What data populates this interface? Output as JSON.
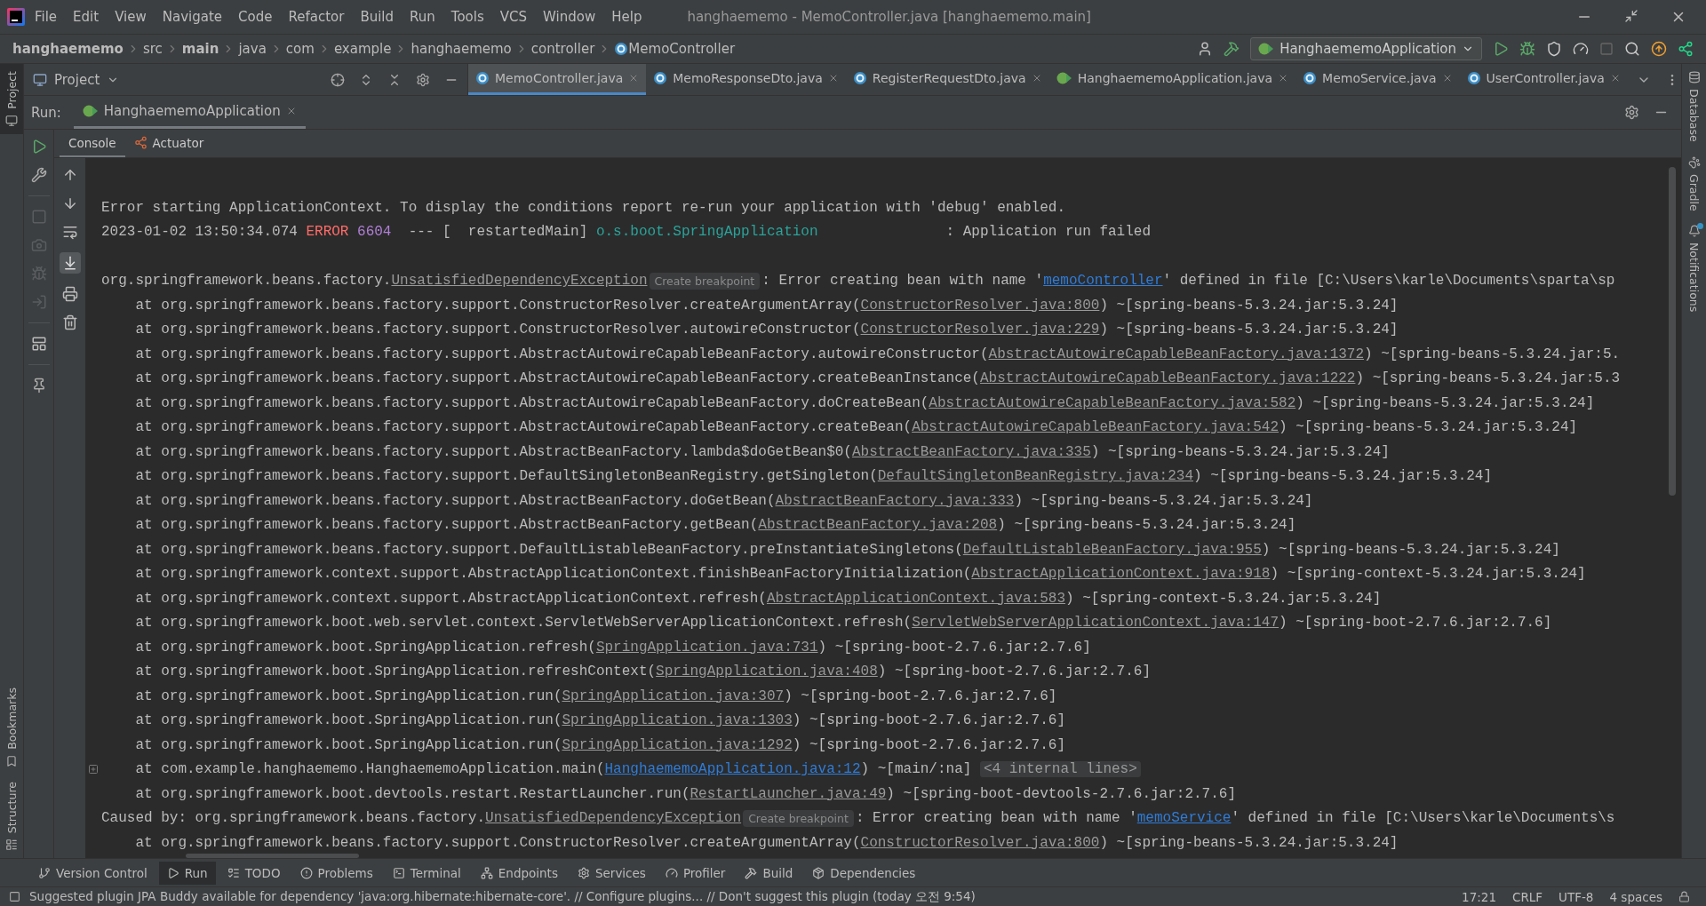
{
  "title_bar": {
    "menu": [
      "File",
      "Edit",
      "View",
      "Navigate",
      "Code",
      "Refactor",
      "Build",
      "Run",
      "Tools",
      "VCS",
      "Window",
      "Help"
    ],
    "title": "hanghaememo - MemoController.java [hanghaememo.main]"
  },
  "nav_bar": {
    "breadcrumbs": [
      {
        "text": "hanghaememo",
        "bold": true,
        "kind": "folder"
      },
      {
        "text": "src",
        "bold": false,
        "kind": "folder"
      },
      {
        "text": "main",
        "bold": true,
        "kind": "folder"
      },
      {
        "text": "java",
        "bold": false,
        "kind": "folder"
      },
      {
        "text": "com",
        "bold": false,
        "kind": "folder"
      },
      {
        "text": "example",
        "bold": false,
        "kind": "folder"
      },
      {
        "text": "hanghaememo",
        "bold": false,
        "kind": "folder"
      },
      {
        "text": "controller",
        "bold": false,
        "kind": "folder"
      },
      {
        "text": "MemoController",
        "bold": false,
        "kind": "class"
      }
    ],
    "run_config": "HanghaememoApplication"
  },
  "project_panel": {
    "title": "Project"
  },
  "editor_tabs": [
    {
      "label": "MemoController.java",
      "selected": true,
      "kind": "class"
    },
    {
      "label": "MemoResponseDto.java",
      "selected": false,
      "kind": "class"
    },
    {
      "label": "RegisterRequestDto.java",
      "selected": false,
      "kind": "class"
    },
    {
      "label": "HanghaememoApplication.java",
      "selected": false,
      "kind": "app"
    },
    {
      "label": "MemoService.java",
      "selected": false,
      "kind": "class"
    },
    {
      "label": "UserController.java",
      "selected": false,
      "kind": "class"
    }
  ],
  "run_panel": {
    "label": "Run:",
    "tabs": [
      {
        "label": "HanghaememoApplication",
        "selected": true
      }
    ],
    "console_tabs": [
      {
        "label": "Console",
        "selected": true,
        "kind": "plain"
      },
      {
        "label": "Actuator",
        "selected": false,
        "kind": "actuator"
      }
    ],
    "lines": [
      {
        "spaced": false,
        "parts": [
          {
            "kind": "text",
            "text": "Error starting ApplicationContext. To display the conditions report re-run your application with 'debug' enabled."
          }
        ]
      },
      {
        "spaced": false,
        "parts": [
          {
            "kind": "text",
            "text": "2023-01-02 13:50:34.074 "
          },
          {
            "kind": "error",
            "text": "ERROR"
          },
          {
            "kind": "pid",
            "text": "6604"
          },
          {
            "kind": "text",
            "text": " --- [  restartedMain] "
          },
          {
            "kind": "logger",
            "text": "o.s.boot.SpringApplication"
          },
          {
            "kind": "text",
            "text": "               : Application run failed"
          }
        ]
      },
      {
        "spaced": true,
        "parts": [
          {
            "kind": "text",
            "text": "org.springframework.beans.factory."
          },
          {
            "kind": "link",
            "text": "UnsatisfiedDependencyException"
          },
          {
            "kind": "hint",
            "text": "Create breakpoint"
          },
          {
            "kind": "text",
            "text": ": Error creating bean with name '"
          },
          {
            "kind": "url",
            "text": "memoController"
          },
          {
            "kind": "text",
            "text": "' defined in file [C:\\Users\\karle\\Documents\\sparta\\sp"
          }
        ]
      },
      {
        "spaced": false,
        "parts": [
          {
            "kind": "text",
            "text": "    at org.springframework.beans.factory.support.ConstructorResolver.createArgumentArray("
          },
          {
            "kind": "link",
            "text": "ConstructorResolver.java:800"
          },
          {
            "kind": "text",
            "text": ") ~[spring-beans-5.3.24.jar:5.3.24]"
          }
        ]
      },
      {
        "spaced": false,
        "parts": [
          {
            "kind": "text",
            "text": "    at org.springframework.beans.factory.support.ConstructorResolver.autowireConstructor("
          },
          {
            "kind": "link",
            "text": "ConstructorResolver.java:229"
          },
          {
            "kind": "text",
            "text": ") ~[spring-beans-5.3.24.jar:5.3.24]"
          }
        ]
      },
      {
        "spaced": false,
        "parts": [
          {
            "kind": "text",
            "text": "    at org.springframework.beans.factory.support.AbstractAutowireCapableBeanFactory.autowireConstructor("
          },
          {
            "kind": "link",
            "text": "AbstractAutowireCapableBeanFactory.java:1372"
          },
          {
            "kind": "text",
            "text": ") ~[spring-beans-5.3.24.jar:5."
          }
        ]
      },
      {
        "spaced": false,
        "parts": [
          {
            "kind": "text",
            "text": "    at org.springframework.beans.factory.support.AbstractAutowireCapableBeanFactory.createBeanInstance("
          },
          {
            "kind": "link",
            "text": "AbstractAutowireCapableBeanFactory.java:1222"
          },
          {
            "kind": "text",
            "text": ") ~[spring-beans-5.3.24.jar:5.3"
          }
        ]
      },
      {
        "spaced": false,
        "parts": [
          {
            "kind": "text",
            "text": "    at org.springframework.beans.factory.support.AbstractAutowireCapableBeanFactory.doCreateBean("
          },
          {
            "kind": "link",
            "text": "AbstractAutowireCapableBeanFactory.java:582"
          },
          {
            "kind": "text",
            "text": ") ~[spring-beans-5.3.24.jar:5.3.24]"
          }
        ]
      },
      {
        "spaced": false,
        "parts": [
          {
            "kind": "text",
            "text": "    at org.springframework.beans.factory.support.AbstractAutowireCapableBeanFactory.createBean("
          },
          {
            "kind": "link",
            "text": "AbstractAutowireCapableBeanFactory.java:542"
          },
          {
            "kind": "text",
            "text": ") ~[spring-beans-5.3.24.jar:5.3.24]"
          }
        ]
      },
      {
        "spaced": false,
        "parts": [
          {
            "kind": "text",
            "text": "    at org.springframework.beans.factory.support.AbstractBeanFactory.lambda$doGetBean$0("
          },
          {
            "kind": "link",
            "text": "AbstractBeanFactory.java:335"
          },
          {
            "kind": "text",
            "text": ") ~[spring-beans-5.3.24.jar:5.3.24]"
          }
        ]
      },
      {
        "spaced": false,
        "parts": [
          {
            "kind": "text",
            "text": "    at org.springframework.beans.factory.support.DefaultSingletonBeanRegistry.getSingleton("
          },
          {
            "kind": "link",
            "text": "DefaultSingletonBeanRegistry.java:234"
          },
          {
            "kind": "text",
            "text": ") ~[spring-beans-5.3.24.jar:5.3.24]"
          }
        ]
      },
      {
        "spaced": false,
        "parts": [
          {
            "kind": "text",
            "text": "    at org.springframework.beans.factory.support.AbstractBeanFactory.doGetBean("
          },
          {
            "kind": "link",
            "text": "AbstractBeanFactory.java:333"
          },
          {
            "kind": "text",
            "text": ") ~[spring-beans-5.3.24.jar:5.3.24]"
          }
        ]
      },
      {
        "spaced": false,
        "parts": [
          {
            "kind": "text",
            "text": "    at org.springframework.beans.factory.support.AbstractBeanFactory.getBean("
          },
          {
            "kind": "link",
            "text": "AbstractBeanFactory.java:208"
          },
          {
            "kind": "text",
            "text": ") ~[spring-beans-5.3.24.jar:5.3.24]"
          }
        ]
      },
      {
        "spaced": false,
        "parts": [
          {
            "kind": "text",
            "text": "    at org.springframework.beans.factory.support.DefaultListableBeanFactory.preInstantiateSingletons("
          },
          {
            "kind": "link",
            "text": "DefaultListableBeanFactory.java:955"
          },
          {
            "kind": "text",
            "text": ") ~[spring-beans-5.3.24.jar:5.3.24]"
          }
        ]
      },
      {
        "spaced": false,
        "parts": [
          {
            "kind": "text",
            "text": "    at org.springframework.context.support.AbstractApplicationContext.finishBeanFactoryInitialization("
          },
          {
            "kind": "link",
            "text": "AbstractApplicationContext.java:918"
          },
          {
            "kind": "text",
            "text": ") ~[spring-context-5.3.24.jar:5.3.24]"
          }
        ]
      },
      {
        "spaced": false,
        "parts": [
          {
            "kind": "text",
            "text": "    at org.springframework.context.support.AbstractApplicationContext.refresh("
          },
          {
            "kind": "link",
            "text": "AbstractApplicationContext.java:583"
          },
          {
            "kind": "text",
            "text": ") ~[spring-context-5.3.24.jar:5.3.24]"
          }
        ]
      },
      {
        "spaced": false,
        "parts": [
          {
            "kind": "text",
            "text": "    at org.springframework.boot.web.servlet.context.ServletWebServerApplicationContext.refresh("
          },
          {
            "kind": "link",
            "text": "ServletWebServerApplicationContext.java:147"
          },
          {
            "kind": "text",
            "text": ") ~[spring-boot-2.7.6.jar:2.7.6]"
          }
        ]
      },
      {
        "spaced": false,
        "parts": [
          {
            "kind": "text",
            "text": "    at org.springframework.boot.SpringApplication.refresh("
          },
          {
            "kind": "link",
            "text": "SpringApplication.java:731"
          },
          {
            "kind": "text",
            "text": ") ~[spring-boot-2.7.6.jar:2.7.6]"
          }
        ]
      },
      {
        "spaced": false,
        "parts": [
          {
            "kind": "text",
            "text": "    at org.springframework.boot.SpringApplication.refreshContext("
          },
          {
            "kind": "link",
            "text": "SpringApplication.java:408"
          },
          {
            "kind": "text",
            "text": ") ~[spring-boot-2.7.6.jar:2.7.6]"
          }
        ]
      },
      {
        "spaced": false,
        "parts": [
          {
            "kind": "text",
            "text": "    at org.springframework.boot.SpringApplication.run("
          },
          {
            "kind": "link",
            "text": "SpringApplication.java:307"
          },
          {
            "kind": "text",
            "text": ") ~[spring-boot-2.7.6.jar:2.7.6]"
          }
        ]
      },
      {
        "spaced": false,
        "parts": [
          {
            "kind": "text",
            "text": "    at org.springframework.boot.SpringApplication.run("
          },
          {
            "kind": "link",
            "text": "SpringApplication.java:1303"
          },
          {
            "kind": "text",
            "text": ") ~[spring-boot-2.7.6.jar:2.7.6]"
          }
        ]
      },
      {
        "spaced": false,
        "parts": [
          {
            "kind": "text",
            "text": "    at org.springframework.boot.SpringApplication.run("
          },
          {
            "kind": "link",
            "text": "SpringApplication.java:1292"
          },
          {
            "kind": "text",
            "text": ") ~[spring-boot-2.7.6.jar:2.7.6]"
          }
        ]
      },
      {
        "spaced": false,
        "parts": [
          {
            "kind": "text",
            "text": "    at com.example.hanghaememo.HanghaememoApplication.main("
          },
          {
            "kind": "url",
            "text": "HanghaememoApplication.java:12"
          },
          {
            "kind": "text",
            "text": ") ~[main/:na] "
          },
          {
            "kind": "fold",
            "text": "<4 internal lines>"
          }
        ]
      },
      {
        "spaced": false,
        "parts": [
          {
            "kind": "text",
            "text": "    at org.springframework.boot.devtools.restart.RestartLauncher.run("
          },
          {
            "kind": "link",
            "text": "RestartLauncher.java:49"
          },
          {
            "kind": "text",
            "text": ") ~[spring-boot-devtools-2.7.6.jar:2.7.6]"
          }
        ]
      },
      {
        "spaced": false,
        "parts": [
          {
            "kind": "text",
            "text": "Caused by: org.springframework.beans.factory."
          },
          {
            "kind": "link",
            "text": "UnsatisfiedDependencyException"
          },
          {
            "kind": "hint",
            "text": "Create breakpoint"
          },
          {
            "kind": "text",
            "text": ": Error creating bean with name '"
          },
          {
            "kind": "url",
            "text": "memoService"
          },
          {
            "kind": "text",
            "text": "' defined in file [C:\\Users\\karle\\Documents\\s"
          }
        ]
      },
      {
        "spaced": false,
        "parts": [
          {
            "kind": "text",
            "text": "    at org.springframework.beans.factory.support.ConstructorResolver.createArgumentArray("
          },
          {
            "kind": "link",
            "text": "ConstructorResolver.java:800"
          },
          {
            "kind": "text",
            "text": ") ~[spring-beans-5.3.24.jar:5.3.24]"
          }
        ]
      }
    ]
  },
  "left_stripe": [
    {
      "label": "Project",
      "selected": true,
      "kind": "project"
    },
    {
      "label": "Bookmarks",
      "selected": false,
      "kind": "bookmarks"
    },
    {
      "label": "Structure",
      "selected": false,
      "kind": "structure"
    }
  ],
  "right_stripe": [
    {
      "label": "Database",
      "kind": "database",
      "unread": false
    },
    {
      "label": "Gradle",
      "kind": "gradle",
      "unread": false
    },
    {
      "label": "Notifications",
      "kind": "notifications",
      "unread": true
    }
  ],
  "tool_tabs": [
    {
      "label": "Version Control",
      "selected": false,
      "kind": "vcs"
    },
    {
      "label": "Run",
      "selected": true,
      "kind": "run"
    },
    {
      "label": "TODO",
      "selected": false,
      "kind": "todo"
    },
    {
      "label": "Problems",
      "selected": false,
      "kind": "problems"
    },
    {
      "label": "Terminal",
      "selected": false,
      "kind": "terminal"
    },
    {
      "label": "Endpoints",
      "selected": false,
      "kind": "endpoints"
    },
    {
      "label": "Services",
      "selected": false,
      "kind": "services"
    },
    {
      "label": "Profiler",
      "selected": false,
      "kind": "profiler"
    },
    {
      "label": "Build",
      "selected": false,
      "kind": "build"
    },
    {
      "label": "Dependencies",
      "selected": false,
      "kind": "dependencies"
    }
  ],
  "status_bar": {
    "message": "Suggested plugin JPA Buddy available for dependency 'java:org.hibernate:hibernate-core'. // Configure plugins... // Don't suggest this plugin (today 오전 9:54)",
    "items": [
      "17:21",
      "CRLF",
      "UTF-8",
      "4 spaces"
    ]
  }
}
